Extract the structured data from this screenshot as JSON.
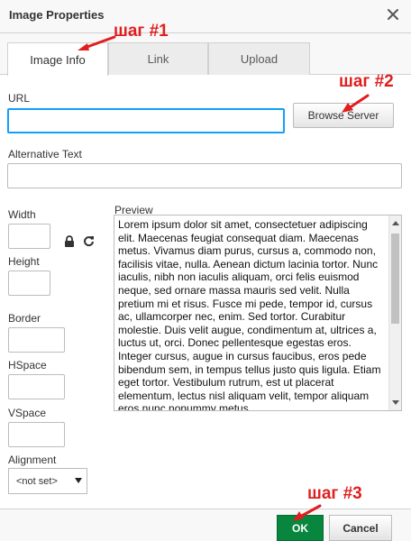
{
  "dialog": {
    "title": "Image Properties",
    "close_icon": "close-icon"
  },
  "tabs": [
    {
      "label": "Image Info",
      "active": true
    },
    {
      "label": "Link",
      "active": false
    },
    {
      "label": "Upload",
      "active": false
    }
  ],
  "url": {
    "label": "URL",
    "value": "",
    "browse_label": "Browse Server"
  },
  "alt_text": {
    "label": "Alternative Text",
    "value": ""
  },
  "dimensions": {
    "width_label": "Width",
    "width_value": "",
    "height_label": "Height",
    "height_value": "",
    "lock_icon": "lock-icon",
    "reset_icon": "refresh-icon"
  },
  "spacing": {
    "border_label": "Border",
    "border_value": "",
    "hspace_label": "HSpace",
    "hspace_value": "",
    "vspace_label": "VSpace",
    "vspace_value": ""
  },
  "alignment": {
    "label": "Alignment",
    "selected": "<not set>"
  },
  "preview": {
    "label": "Preview",
    "text": "Lorem ipsum dolor sit amet, consectetuer adipiscing elit. Maecenas feugiat consequat diam. Maecenas metus. Vivamus diam purus, cursus a, commodo non, facilisis vitae, nulla. Aenean dictum lacinia tortor. Nunc iaculis, nibh non iaculis aliquam, orci felis euismod neque, sed ornare massa mauris sed velit. Nulla pretium mi et risus. Fusce mi pede, tempor id, cursus ac, ullamcorper nec, enim. Sed tortor. Curabitur molestie. Duis velit augue, condimentum at, ultrices a, luctus ut, orci. Donec pellentesque egestas eros. Integer cursus, augue in cursus faucibus, eros pede bibendum sem, in tempus tellus justo quis ligula. Etiam eget tortor. Vestibulum rutrum, est ut placerat elementum, lectus nisl aliquam velit, tempor aliquam eros nunc nonummy metus."
  },
  "footer": {
    "ok_label": "OK",
    "cancel_label": "Cancel"
  },
  "annotations": {
    "step1": "шаг #1",
    "step2": "шаг #2",
    "step3": "шаг #3",
    "color": "#e01e1e"
  },
  "colors": {
    "focus": "#139ff7",
    "ok_button": "#09863e"
  }
}
